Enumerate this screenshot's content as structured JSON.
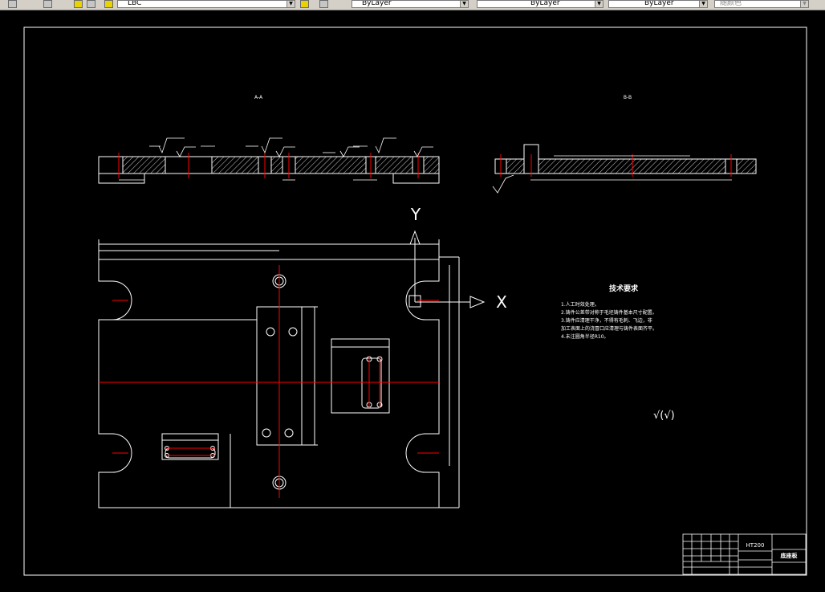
{
  "toolbar": {
    "layer_name": "LBC",
    "color_combo": "ByLayer",
    "linetype_combo": "ByLayer",
    "lineweight_combo": "ByLayer",
    "plotstyle_combo": "随颜色"
  },
  "drawing": {
    "section_a_label": "A-A",
    "section_b_label": "B-B",
    "axis_x_label": "X",
    "axis_y_label": "Y",
    "tech_req_title": "技术要求",
    "tech_req_lines": [
      "1.人工时效处理。",
      "2.铸件公差带对称于毛坯铸件基本尺寸配置。",
      "3.铸件应清理干净，不得有毛刺、飞边，非",
      "加工表面上的浇冒口应清理与铸件表面齐平。",
      "4.未注圆角半径R10。"
    ],
    "roughness_note": "√(√)",
    "title_block_code": "HT200",
    "title_block_name": "底座板"
  },
  "colors": {
    "background": "#000000",
    "line_white": "#ffffff",
    "center_red": "#ff0000"
  }
}
